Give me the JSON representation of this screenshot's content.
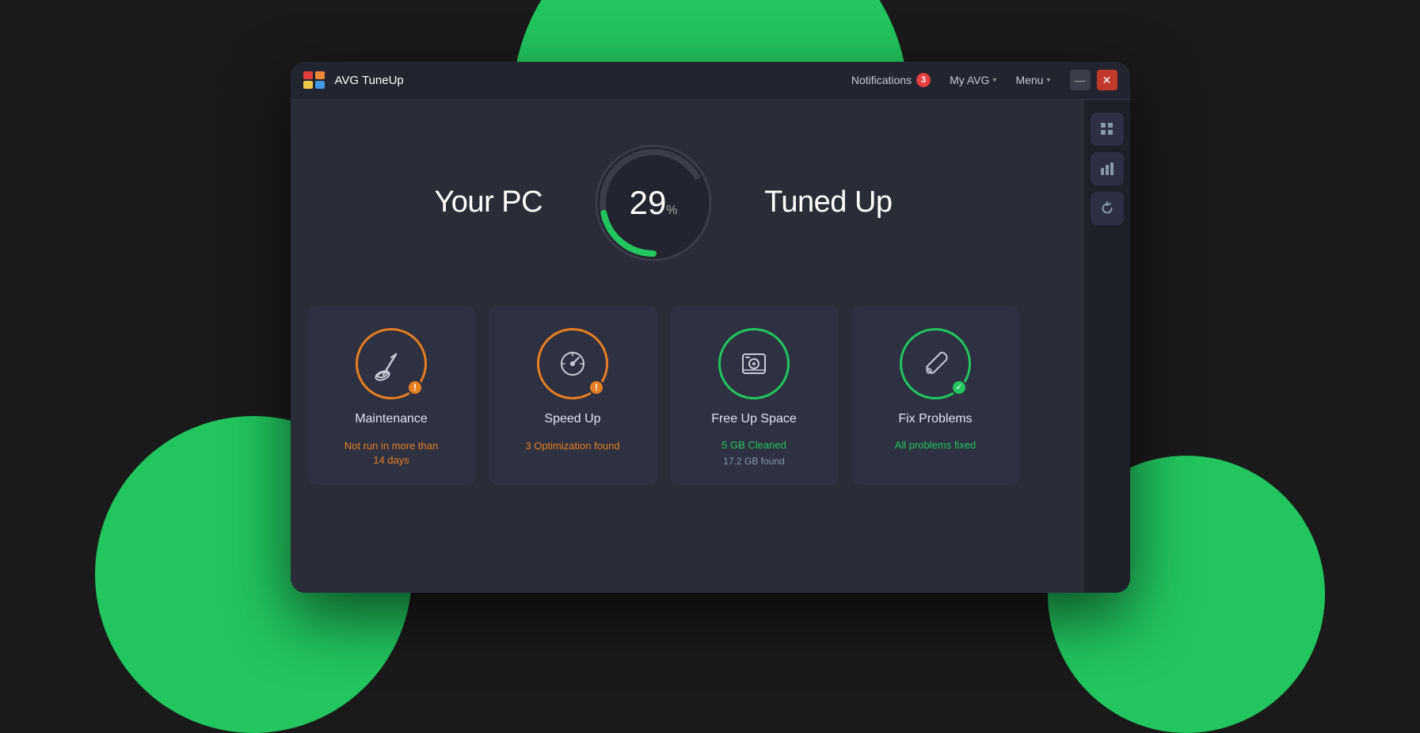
{
  "app": {
    "name": "AVG  TuneUp",
    "logo_colors": [
      "#e53e3e",
      "#ed8936",
      "#ecc94b",
      "#4299e1"
    ]
  },
  "titlebar": {
    "notifications_label": "Notifications",
    "notifications_count": "3",
    "my_avg_label": "My AVG",
    "menu_label": "Menu",
    "minimize_label": "—",
    "close_label": "✕"
  },
  "sidebar": {
    "icons": [
      "⊞",
      "▐▐",
      "↺"
    ]
  },
  "hero": {
    "your_pc": "Your PC",
    "tuned_up": "Tuned Up",
    "gauge_value": "29",
    "gauge_unit": "%",
    "gauge_percent": 29
  },
  "cards": [
    {
      "id": "maintenance",
      "title": "Maintenance",
      "status_type": "warning",
      "status_line1": "Not run in more than",
      "status_line2": "14 days",
      "ring_color": "orange",
      "has_warning": true,
      "has_success": false
    },
    {
      "id": "speed-up",
      "title": "Speed Up",
      "status_type": "warning",
      "status_line1": "3 Optimization found",
      "status_line2": "",
      "ring_color": "orange",
      "has_warning": true,
      "has_success": false
    },
    {
      "id": "free-up-space",
      "title": "Free Up Space",
      "status_type": "green",
      "status_line1": "5 GB Cleaned",
      "status_line2": "17.2 GB found",
      "ring_color": "green",
      "has_warning": false,
      "has_success": false
    },
    {
      "id": "fix-problems",
      "title": "Fix Problems",
      "status_type": "green_success",
      "status_line1": "All problems fixed",
      "status_line2": "",
      "ring_color": "green",
      "has_warning": false,
      "has_success": true
    }
  ]
}
